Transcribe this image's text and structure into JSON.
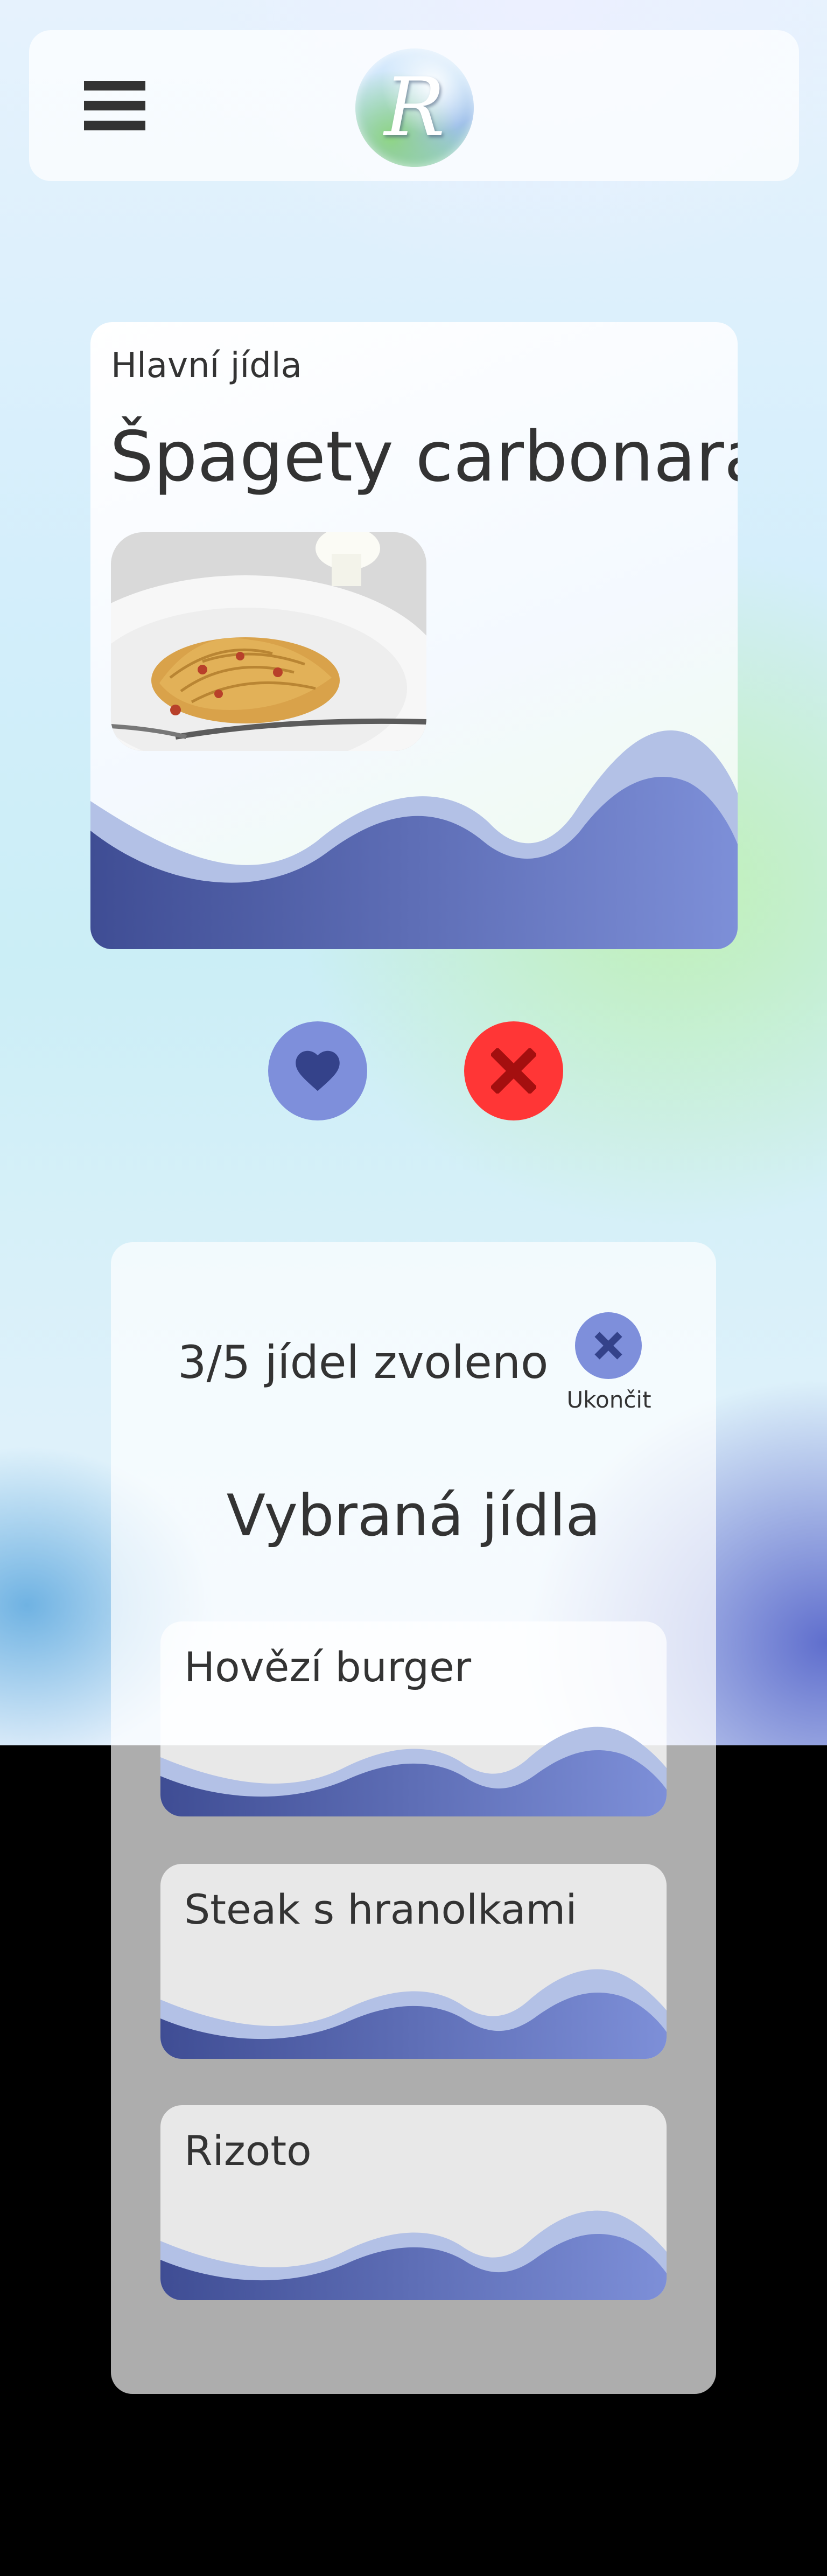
{
  "header": {
    "menu_icon": "hamburger-menu-icon",
    "logo_letter": "R"
  },
  "dish_card": {
    "category": "Hlavní jídla",
    "title": "Špagety carbonara",
    "photo": "spaghetti-carbonara-photo"
  },
  "actions": {
    "like_icon": "heart-icon",
    "dislike_icon": "close-icon",
    "like_color": "#7e8fdb",
    "dislike_color": "#ff3636"
  },
  "selection": {
    "progress": "3/5 jídel zvoleno",
    "selected_count": 3,
    "total_count": 5,
    "end_label": "Ukončit",
    "heading": "Vybraná jídla",
    "items": [
      {
        "name": "Hovězí burger"
      },
      {
        "name": "Steak s hranolkami"
      },
      {
        "name": "Rizoto"
      }
    ]
  },
  "colors": {
    "wave_dark": "#3f4d94",
    "wave_light": "#7d8fd8",
    "accent": "#7e8fdb"
  }
}
